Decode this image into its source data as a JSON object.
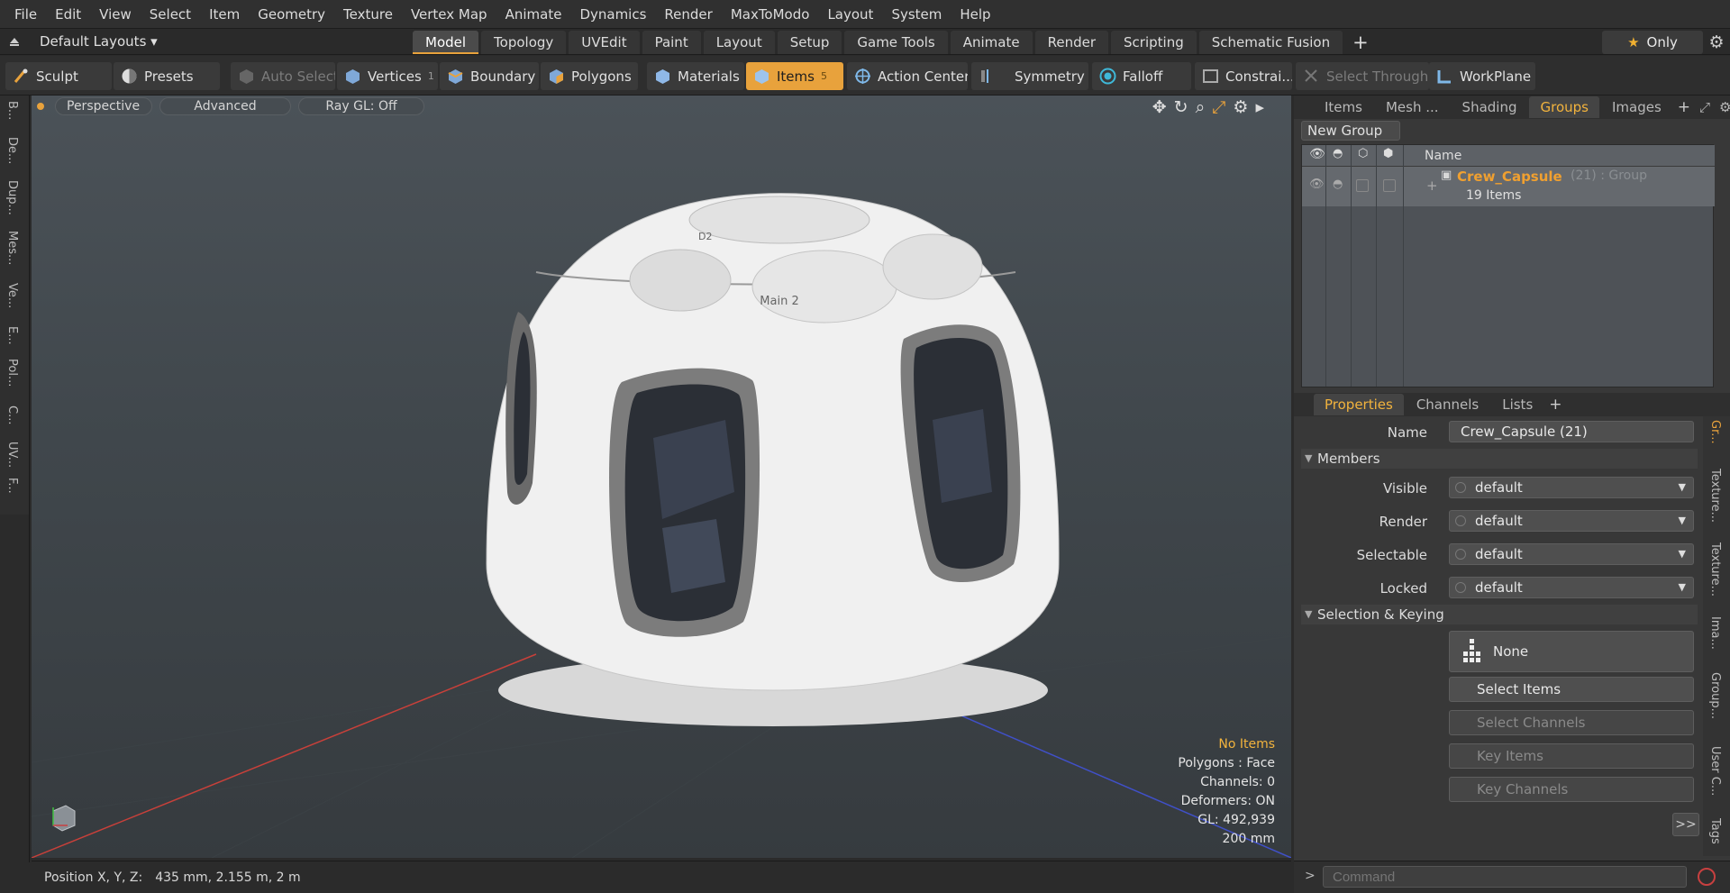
{
  "menu": [
    "File",
    "Edit",
    "View",
    "Select",
    "Item",
    "Geometry",
    "Texture",
    "Vertex Map",
    "Animate",
    "Dynamics",
    "Render",
    "MaxToModo",
    "Layout",
    "System",
    "Help"
  ],
  "layout": {
    "label": "Default Layouts"
  },
  "tabs": [
    {
      "label": "Model",
      "active": true
    },
    {
      "label": "Topology"
    },
    {
      "label": "UVEdit"
    },
    {
      "label": "Paint"
    },
    {
      "label": "Layout"
    },
    {
      "label": "Setup"
    },
    {
      "label": "Game Tools"
    },
    {
      "label": "Animate"
    },
    {
      "label": "Render"
    },
    {
      "label": "Scripting"
    },
    {
      "label": "Schematic Fusion"
    }
  ],
  "only_label": "Only",
  "toolbar": {
    "sculpt": "Sculpt",
    "presets": "Presets",
    "auto_select": "Auto Select",
    "vertices": "Vertices",
    "vertices_count": "1",
    "boundary": "Boundary",
    "polygons": "Polygons",
    "materials": "Materials",
    "items": "Items",
    "items_count": "5",
    "action_center": "Action Center",
    "symmetry": "Symmetry",
    "falloff": "Falloff",
    "constraints": "Constrai...",
    "select_through": "Select Through",
    "workplane": "WorkPlane"
  },
  "left_strip": [
    "B...",
    "De...",
    "Dup...",
    "Mes...",
    "Ve...",
    "E...",
    "Pol...",
    "C...",
    "UV...",
    "F..."
  ],
  "viewport": {
    "view": "Perspective",
    "advanced": "Advanced",
    "raygl": "Ray GL: Off",
    "texture_labels": {
      "main": "Main 2",
      "d2": "D2"
    },
    "stats": {
      "no_items": "No Items",
      "polygons": "Polygons : Face",
      "channels": "Channels: 0",
      "deformers": "Deformers: ON",
      "gl": "GL: 492,939",
      "scale": "200 mm"
    }
  },
  "status": {
    "label": "Position X, Y, Z:",
    "value": "435 mm, 2.155 m, 2 m"
  },
  "top_panel": {
    "tabs": [
      {
        "label": "Items"
      },
      {
        "label": "Mesh ..."
      },
      {
        "label": "Shading"
      },
      {
        "label": "Groups",
        "active": true
      },
      {
        "label": "Images"
      }
    ],
    "new_group": "New Group",
    "header_name": "Name",
    "group": {
      "name": "Crew_Capsule",
      "meta": "(21) : Group",
      "items": "19 Items"
    }
  },
  "props_panel": {
    "tabs": [
      {
        "label": "Properties",
        "active": true
      },
      {
        "label": "Channels"
      },
      {
        "label": "Lists"
      }
    ],
    "name_label": "Name",
    "name_value": "Crew_Capsule (21)",
    "members_title": "Members",
    "visible_label": "Visible",
    "visible_value": "default",
    "render_label": "Render",
    "render_value": "default",
    "selectable_label": "Selectable",
    "selectable_value": "default",
    "locked_label": "Locked",
    "locked_value": "default",
    "keying_title": "Selection & Keying",
    "none": "None",
    "select_items": "Select Items",
    "select_channels": "Select Channels",
    "key_items": "Key Items",
    "key_channels": "Key Channels",
    "more": ">>"
  },
  "right_strip": [
    "Gr...",
    "Texture...",
    "Texture...",
    "Ima...",
    "Group...",
    "User C...",
    "Tags"
  ],
  "command_placeholder": "Command",
  "colors": {
    "accent": "#e8a23c",
    "x_axis": "#c8403a",
    "z_axis": "#4050c8"
  }
}
